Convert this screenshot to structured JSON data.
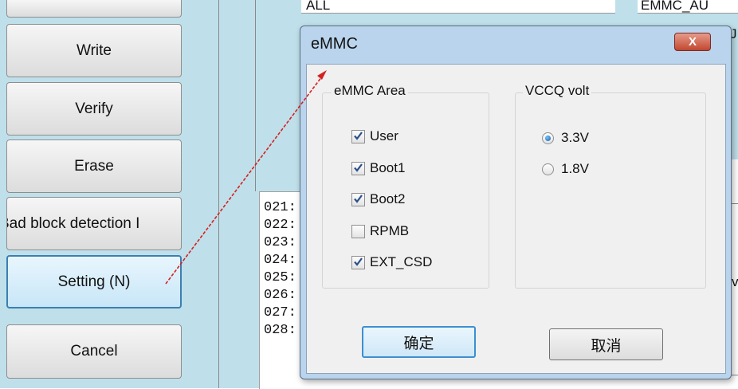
{
  "sidebar": {
    "buttons": [
      {
        "id": "write",
        "label": "Write"
      },
      {
        "id": "verify",
        "label": "Verify"
      },
      {
        "id": "erase",
        "label": "Erase"
      },
      {
        "id": "bad_block",
        "label": "Bad block detection I"
      },
      {
        "id": "setting",
        "label": "Setting (N)"
      },
      {
        "id": "cancel",
        "label": "Cancel"
      }
    ]
  },
  "background": {
    "top_cell_1": "ALL",
    "top_cell_2": "EMMC_AU",
    "right_glyph_1": "J",
    "right_glyph_2": "v",
    "log_lines": [
      "021:",
      "022:",
      "023:",
      "024:",
      "025:",
      "026:",
      "027:",
      "028:"
    ]
  },
  "dialog": {
    "title": "eMMC",
    "close_symbol": "X",
    "area_group": {
      "label": "eMMC Area",
      "options": [
        {
          "label": "User",
          "checked": true
        },
        {
          "label": "Boot1",
          "checked": true
        },
        {
          "label": "Boot2",
          "checked": true
        },
        {
          "label": "RPMB",
          "checked": false
        },
        {
          "label": "EXT_CSD",
          "checked": true
        }
      ]
    },
    "volt_group": {
      "label": "VCCQ volt",
      "options": [
        {
          "label": "3.3V",
          "selected": true
        },
        {
          "label": "1.8V",
          "selected": false
        }
      ]
    },
    "ok_label": "确定",
    "cancel_label": "取消"
  },
  "colors": {
    "panel_bg": "#bfe0ea",
    "dialog_frame": "#b9d4ec",
    "close_red": "#c2472f",
    "arrow_red": "#d62020",
    "focus_blue": "#3c8fd0"
  }
}
